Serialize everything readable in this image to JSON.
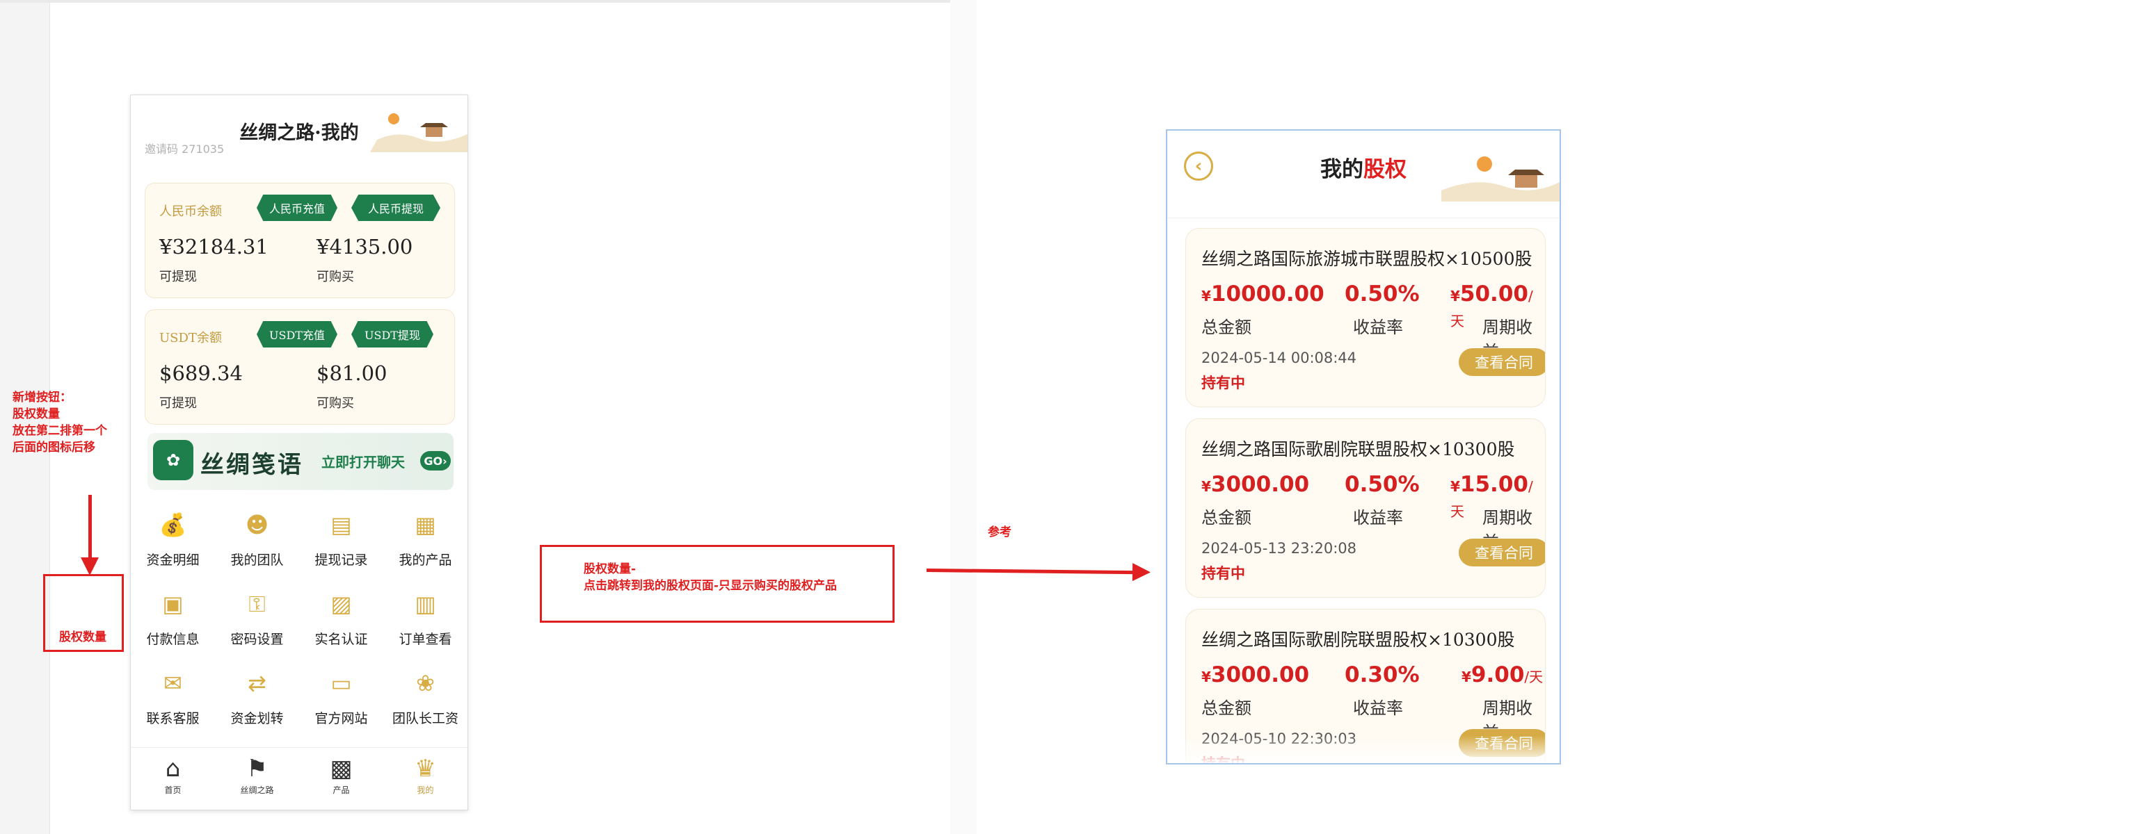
{
  "left_phone": {
    "title": "丝绸之路·我的",
    "subtitle": "邀请码 271035",
    "rmb_card": {
      "title": "人民币余额",
      "recharge": "人民币充值",
      "withdraw": "人民币提现",
      "withdrawable_value": "¥32184.31",
      "withdrawable_label": "可提现",
      "purchasable_value": "¥4135.00",
      "purchasable_label": "可购买"
    },
    "usdt_card": {
      "title": "USDT余额",
      "recharge": "USDT充值",
      "withdraw": "USDT提现",
      "withdrawable_value": "$689.34",
      "withdrawable_label": "可提现",
      "purchasable_value": "$81.00",
      "purchasable_label": "可购买"
    },
    "banner": {
      "text": "丝绸笺语",
      "cta": "立即打开聊天",
      "go": "GO›"
    },
    "grid": [
      {
        "label": "资金明细",
        "icon": "money-bag-icon"
      },
      {
        "label": "我的团队",
        "icon": "team-icon"
      },
      {
        "label": "提现记录",
        "icon": "withdraw-record-icon"
      },
      {
        "label": "我的产品",
        "icon": "product-grid-icon"
      },
      {
        "label": "付款信息",
        "icon": "payment-info-icon"
      },
      {
        "label": "密码设置",
        "icon": "password-icon"
      },
      {
        "label": "实名认证",
        "icon": "id-card-icon"
      },
      {
        "label": "订单查看",
        "icon": "order-icon"
      },
      {
        "label": "联系客服",
        "icon": "chat-icon"
      },
      {
        "label": "资金划转",
        "icon": "transfer-icon"
      },
      {
        "label": "官方网站",
        "icon": "website-icon"
      },
      {
        "label": "团队长工资",
        "icon": "salary-icon"
      }
    ],
    "tabbar": [
      {
        "label": "首页",
        "icon": "home-icon"
      },
      {
        "label": "丝绸之路",
        "icon": "signpost-icon"
      },
      {
        "label": "产品",
        "icon": "box-icon"
      },
      {
        "label": "我的",
        "icon": "profile-icon"
      }
    ]
  },
  "annotations": {
    "new_button_note": [
      "新增按钮：",
      "股权数量",
      "放在第二排第一个",
      "后面的图标后移"
    ],
    "equity_box_label": "股权数量",
    "middle_note": [
      "股权数量-",
      "点击跳转到我的股权页面-只显示购买的股权产品"
    ],
    "reference_label": "参考"
  },
  "right_phone": {
    "title_plain": "我的",
    "title_highlight": "股权",
    "cards": [
      {
        "title": "丝绸之路国际旅游城市联盟股权×10500股",
        "total_amount": "10000.00",
        "total_amount_label": "总金额",
        "yield_rate": "0.50%",
        "yield_rate_label": "收益率",
        "period_income": "50.00",
        "period_unit": "/天",
        "period_income_label": "周期收益",
        "date": "2024-05-14 00:08:44",
        "status": "持有中",
        "button": "查看合同"
      },
      {
        "title": "丝绸之路国际歌剧院联盟股权×10300股",
        "total_amount": "3000.00",
        "total_amount_label": "总金额",
        "yield_rate": "0.50%",
        "yield_rate_label": "收益率",
        "period_income": "15.00",
        "period_unit": "/天",
        "period_income_label": "周期收益",
        "date": "2024-05-13 23:20:08",
        "status": "持有中",
        "button": "查看合同"
      },
      {
        "title": "丝绸之路国际歌剧院联盟股权×10300股",
        "total_amount": "3000.00",
        "total_amount_label": "总金额",
        "yield_rate": "0.30%",
        "yield_rate_label": "收益率",
        "period_income": "9.00",
        "period_unit": "/天",
        "period_income_label": "周期收益",
        "date": "2024-05-10 22:30:03",
        "status": "持有中",
        "button": "查看合同"
      }
    ],
    "yen": "¥"
  },
  "colors": {
    "accent_gold": "#d8ad44",
    "green": "#1e7e4c",
    "annotation_red": "#e02020",
    "value_red": "#d42020"
  }
}
